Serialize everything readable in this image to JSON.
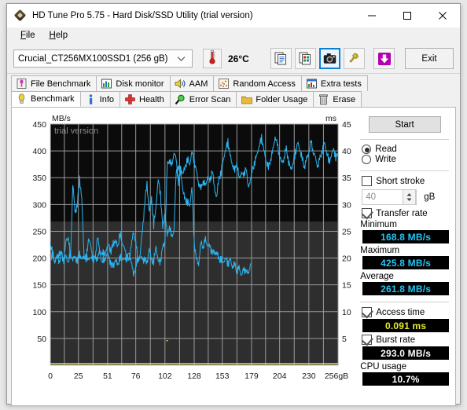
{
  "window": {
    "title": "HD Tune Pro 5.75 - Hard Disk/SSD Utility (trial version)",
    "app_icon": "diamond-logo-icon",
    "minimize_label": "—",
    "maximize_label": "□",
    "close_label": "✕"
  },
  "menu": {
    "items": [
      {
        "label": "File",
        "accel": "F"
      },
      {
        "label": "Help",
        "accel": "H"
      }
    ]
  },
  "toolbar": {
    "drive_selected": "Crucial_CT256MX100SSD1 (256 gB)",
    "drive_dropdown_icon": "chevron-down-icon",
    "temperature_icon": "thermometer-icon",
    "temperature": "26°C",
    "buttons": [
      {
        "name": "copy-text-button",
        "icon": "copy-text-icon",
        "active": false
      },
      {
        "name": "copy-image-button",
        "icon": "copy-image-icon",
        "active": false
      },
      {
        "name": "screenshot-button",
        "icon": "camera-icon",
        "active": true
      },
      {
        "name": "tools-button",
        "icon": "wrench-icon",
        "active": false
      },
      {
        "name": "download-button",
        "icon": "download-arrow-icon",
        "active": false
      }
    ],
    "exit_label": "Exit"
  },
  "tabs": {
    "row1": [
      {
        "label": "File Benchmark",
        "icon": "file-benchmark-icon",
        "selected": false
      },
      {
        "label": "Disk monitor",
        "icon": "bar-chart-icon",
        "selected": false
      },
      {
        "label": "AAM",
        "icon": "speaker-icon",
        "selected": false
      },
      {
        "label": "Random Access",
        "icon": "scatter-icon",
        "selected": false
      },
      {
        "label": "Extra tests",
        "icon": "extra-tests-icon",
        "selected": false
      }
    ],
    "row2": [
      {
        "label": "Benchmark",
        "icon": "bulb-icon",
        "selected": true
      },
      {
        "label": "Info",
        "icon": "info-icon",
        "selected": false
      },
      {
        "label": "Health",
        "icon": "health-cross-icon",
        "selected": false
      },
      {
        "label": "Error Scan",
        "icon": "magnifier-icon",
        "selected": false
      },
      {
        "label": "Folder Usage",
        "icon": "folder-icon",
        "selected": false
      },
      {
        "label": "Erase",
        "icon": "trash-icon",
        "selected": false
      }
    ]
  },
  "chart_data": {
    "type": "line",
    "title": "",
    "watermark": "trial version",
    "ylabel_left": "MB/s",
    "ylabel_right": "ms",
    "xlabel": "gB",
    "x_ticks": [
      "0",
      "25",
      "51",
      "76",
      "102",
      "128",
      "153",
      "179",
      "204",
      "230",
      "256gB"
    ],
    "x_tick_values": [
      0,
      25,
      51,
      76,
      102,
      128,
      153,
      179,
      204,
      230,
      256
    ],
    "xlim": [
      0,
      256
    ],
    "y_left_ticks": [
      "50",
      "100",
      "150",
      "200",
      "250",
      "300",
      "350",
      "400",
      "450"
    ],
    "y_left_tick_values": [
      50,
      100,
      150,
      200,
      250,
      300,
      350,
      400,
      450
    ],
    "ylim_left": [
      0,
      450
    ],
    "y_right_ticks": [
      "5",
      "10",
      "15",
      "20",
      "25",
      "30",
      "35",
      "40",
      "45"
    ],
    "y_right_tick_values": [
      5,
      10,
      15,
      20,
      25,
      30,
      35,
      40,
      45
    ],
    "ylim_right": [
      0,
      45
    ],
    "grid": true,
    "plot_bg": "#2e2e2e",
    "series": [
      {
        "name": "Transfer rate",
        "color": "#2ab4f0",
        "axis": "left",
        "unit": "MB/s",
        "x": [
          0,
          2,
          4,
          6,
          8,
          10,
          12,
          14,
          16,
          18,
          20,
          22,
          24,
          26,
          28,
          30,
          32,
          34,
          36,
          38,
          40,
          42,
          44,
          46,
          48,
          50,
          52,
          54,
          56,
          58,
          60,
          62,
          64,
          66,
          68,
          70,
          72,
          74,
          76,
          78,
          80,
          82,
          84,
          86,
          88,
          90,
          92,
          94,
          96,
          98,
          100,
          102,
          104,
          106,
          108,
          110,
          112,
          114,
          116,
          118,
          120,
          122,
          124,
          126,
          128,
          130,
          132,
          134,
          136,
          138,
          140,
          142,
          144,
          146,
          148,
          150,
          152,
          154,
          156,
          158,
          160,
          162,
          164,
          166,
          168,
          170,
          172,
          174,
          176,
          178
        ],
        "values": [
          228,
          208,
          195,
          199,
          212,
          205,
          197,
          232,
          241,
          198,
          340,
          285,
          300,
          349,
          310,
          205,
          196,
          240,
          220,
          198,
          196,
          245,
          207,
          196,
          193,
          208,
          202,
          189,
          186,
          196,
          188,
          199,
          201,
          195,
          202,
          206,
          198,
          165,
          188,
          194,
          204,
          196,
          200,
          190,
          218,
          196,
          192,
          225,
          192,
          196,
          218,
          233,
          373,
          385,
          369,
          399,
          382,
          342,
          363,
          325,
          308,
          304,
          298,
          332,
          230,
          196,
          190,
          228,
          222,
          233,
          225,
          219,
          214,
          208,
          212,
          196,
          198,
          192,
          200,
          190,
          196,
          184,
          188,
          176,
          180,
          170,
          176,
          180,
          168,
          190
        ]
      },
      {
        "name": "Access time",
        "color": "#2ab4f0",
        "axis": "right",
        "unit": "ms",
        "x": [
          0,
          2,
          4,
          6,
          8,
          10,
          12,
          14,
          16,
          18,
          20,
          22,
          24,
          26,
          28,
          30,
          32,
          34,
          36,
          38,
          40,
          42,
          44,
          46,
          48,
          50,
          52,
          54,
          56,
          58,
          60,
          62,
          64,
          66,
          68,
          70,
          72,
          74,
          76,
          78,
          80,
          82,
          84,
          86,
          88,
          90,
          92,
          94,
          96,
          98,
          100,
          102,
          104,
          106,
          108,
          110,
          112,
          114,
          116,
          118,
          120,
          122,
          124,
          126,
          128,
          130,
          132,
          134,
          136,
          138,
          140,
          142,
          144,
          146,
          148,
          150,
          152,
          154,
          156,
          158,
          160,
          162,
          164,
          166,
          168,
          170,
          172,
          174,
          176,
          178,
          180,
          182,
          184,
          186,
          188,
          190,
          192,
          194,
          196,
          198,
          200,
          202,
          204,
          206,
          208,
          210,
          212,
          214,
          216,
          218,
          220,
          222,
          224,
          226,
          228,
          230,
          232,
          234,
          236,
          238,
          240,
          242,
          244,
          246,
          248,
          250,
          252,
          254,
          256
        ],
        "values": [
          19.8,
          20.4,
          19.6,
          20.2,
          19.5,
          20.8,
          19.7,
          20.3,
          19.4,
          20.6,
          19.8,
          20.2,
          19.5,
          20.9,
          19.6,
          20.4,
          19.8,
          20.1,
          19.7,
          20.5,
          19.6,
          20.3,
          20.9,
          21.2,
          20.4,
          21.8,
          22.4,
          21.3,
          22.8,
          23.1,
          22.2,
          24.3,
          23.0,
          21.6,
          20.5,
          19.2,
          22.8,
          24.5,
          23.4,
          19.2,
          21.0,
          25.0,
          30.5,
          33.8,
          28.6,
          31.2,
          26.0,
          29.8,
          34.5,
          32.2,
          25.2,
          28.9,
          24.0,
          26.2,
          23.6,
          25.4,
          35.8,
          37.2,
          36.6,
          35.8,
          36.9,
          38.4,
          37.5,
          39.8,
          38.2,
          36.0,
          34.0,
          32.8,
          34.6,
          33.2,
          35.5,
          34.0,
          36.8,
          33.0,
          31.5,
          34.8,
          36.0,
          38.5,
          40.2,
          41.8,
          39.0,
          37.5,
          36.2,
          38.0,
          34.5,
          36.2,
          35.0,
          37.4,
          33.0,
          34.8,
          36.5,
          38.0,
          39.5,
          41.0,
          42.5,
          40.0,
          38.2,
          36.8,
          38.5,
          40.0,
          42.8,
          41.0,
          39.2,
          37.6,
          38.8,
          40.4,
          38.0,
          36.5,
          37.8,
          39.6,
          41.5,
          40.2,
          38.6,
          37.0,
          38.4,
          39.8,
          41.6,
          40.0,
          38.5,
          37.2,
          38.6,
          40.2,
          41.5,
          39.6,
          38.0,
          39.0,
          40.5,
          38.6,
          39.8
        ]
      },
      {
        "name": "baseline",
        "color": "#e8e82c",
        "axis": "left",
        "unit": "MB/s",
        "x": [
          0,
          256
        ],
        "values": [
          3,
          3
        ]
      }
    ]
  },
  "panel": {
    "start_label": "Start",
    "mode": {
      "read_label": "Read",
      "read_selected": true,
      "write_label": "Write",
      "write_selected": false
    },
    "short_stroke": {
      "label": "Short stroke",
      "checked": false,
      "value": "40",
      "unit": "gB",
      "spinner_icon": "spinner-arrows-icon"
    },
    "transfer_rate": {
      "label": "Transfer rate",
      "checked": true,
      "metrics": [
        {
          "label": "Minimum",
          "value": "168.8 MB/s",
          "color": "cyan"
        },
        {
          "label": "Maximum",
          "value": "425.8 MB/s",
          "color": "cyan"
        },
        {
          "label": "Average",
          "value": "261.8 MB/s",
          "color": "cyan"
        }
      ]
    },
    "access_time": {
      "label": "Access time",
      "checked": true,
      "value": "0.091 ms",
      "color": "yellow"
    },
    "burst_rate": {
      "label": "Burst rate",
      "checked": true,
      "value": "293.0 MB/s",
      "color": "white"
    },
    "cpu_usage": {
      "label": "CPU usage",
      "value": "10.7%",
      "color": "white"
    }
  },
  "colors": {
    "accent": "#0a7fd4",
    "transfer_line": "#2ab4f0",
    "access_line": "#e8e82c",
    "plot_bg": "#2e2e2e",
    "plot_bg_top": "#0a0a0a"
  }
}
